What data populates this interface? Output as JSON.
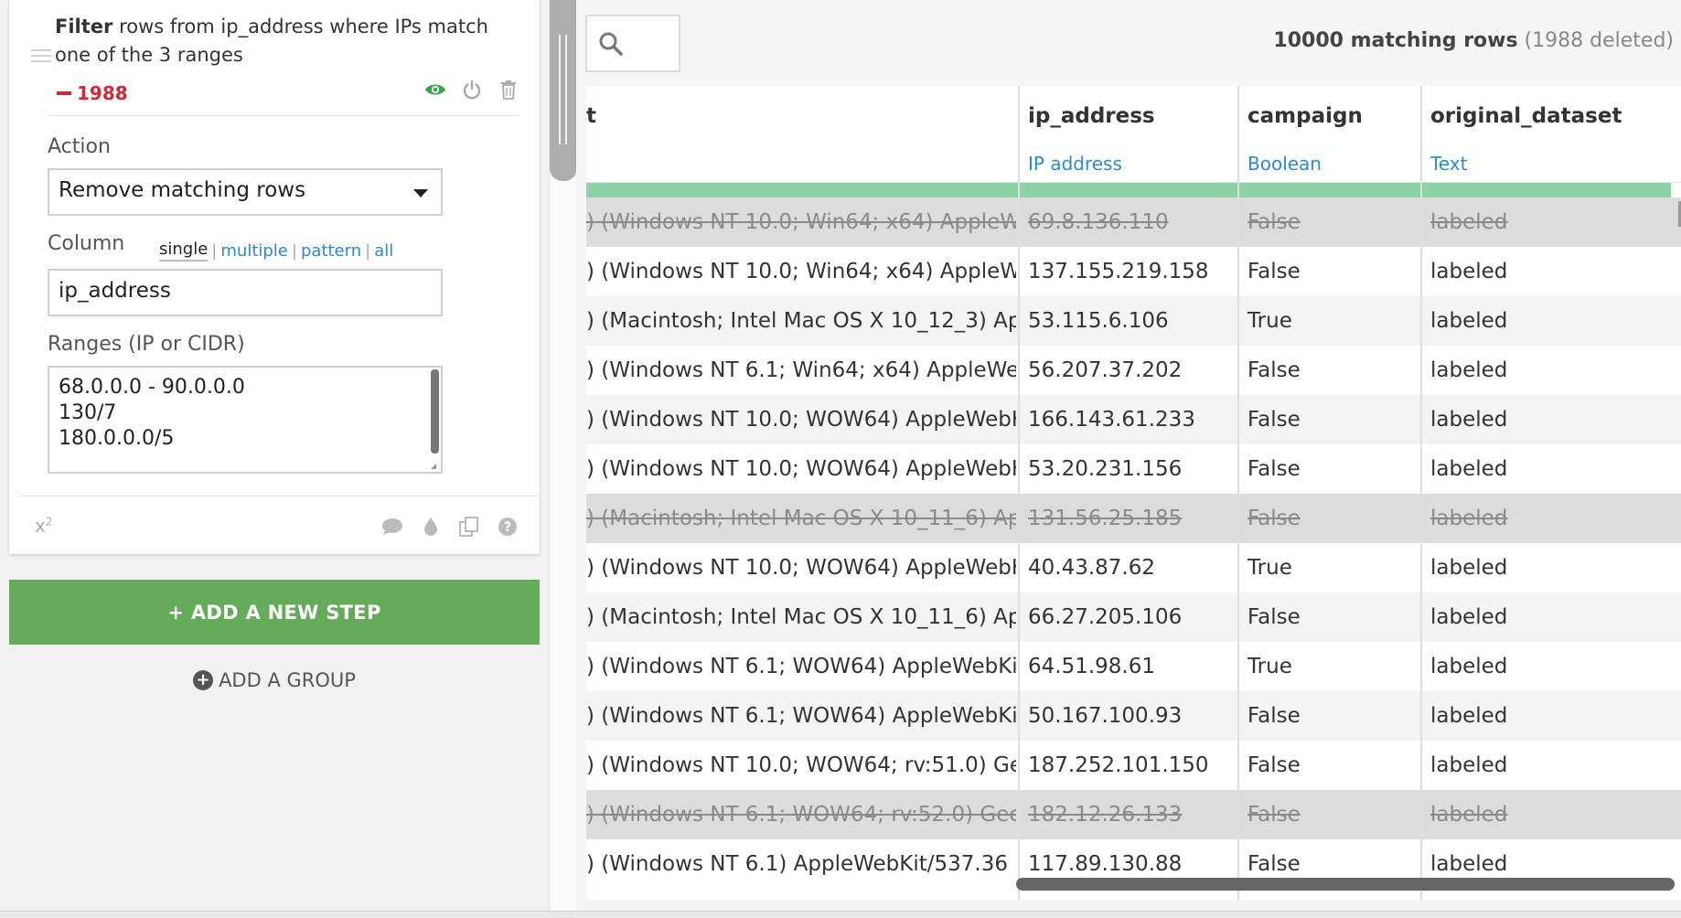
{
  "step": {
    "title_bold": "Filter",
    "title_rest": " rows from ip_address where IPs match one of the 3 ranges",
    "delete_count": "1988",
    "action_label": "Action",
    "action_value": "Remove matching rows",
    "column_label": "Column",
    "column_modes": [
      "single",
      "multiple",
      "pattern",
      "all"
    ],
    "column_value": "ip_address",
    "ranges_label": "Ranges (IP or CIDR)",
    "ranges": [
      "68.0.0.0 - 90.0.0.0",
      "130/7",
      "180.0.0.0/5"
    ],
    "footer_left": "x",
    "footer_left_sup": "2"
  },
  "buttons": {
    "add_step": "+ ADD A NEW STEP",
    "add_group": "ADD A GROUP",
    "add_group_icon": "+"
  },
  "grid": {
    "matching_count": "10000 matching rows",
    "deleted_note": "(1988 deleted)",
    "columns": [
      {
        "name": "t",
        "type": ""
      },
      {
        "name": "ip_address",
        "type": "IP address"
      },
      {
        "name": "campaign",
        "type": "Boolean"
      },
      {
        "name": "original_dataset",
        "type": "Text"
      }
    ],
    "rows": [
      {
        "ua": ") (Windows NT 10.0; Win64; x64) AppleW…",
        "ip": "69.8.136.110",
        "campaign": "False",
        "dataset": "labeled",
        "deleted": true
      },
      {
        "ua": ") (Windows NT 10.0; Win64; x64) AppleW…",
        "ip": "137.155.219.158",
        "campaign": "False",
        "dataset": "labeled",
        "deleted": false
      },
      {
        "ua": ") (Macintosh; Intel Mac OS X 10_12_3) Ap…",
        "ip": "53.115.6.106",
        "campaign": "True",
        "dataset": "labeled",
        "deleted": false
      },
      {
        "ua": ") (Windows NT 6.1; Win64; x64) AppleWe…",
        "ip": "56.207.37.202",
        "campaign": "False",
        "dataset": "labeled",
        "deleted": false
      },
      {
        "ua": ") (Windows NT 10.0; WOW64) AppleWebK…",
        "ip": "166.143.61.233",
        "campaign": "False",
        "dataset": "labeled",
        "deleted": false
      },
      {
        "ua": ") (Windows NT 10.0; WOW64) AppleWebK…",
        "ip": "53.20.231.156",
        "campaign": "False",
        "dataset": "labeled",
        "deleted": false
      },
      {
        "ua": ") (Macintosh; Intel Mac OS X 10_11_6) Ap…",
        "ip": "131.56.25.185",
        "campaign": "False",
        "dataset": "labeled",
        "deleted": true
      },
      {
        "ua": ") (Windows NT 10.0; WOW64) AppleWebK…",
        "ip": "40.43.87.62",
        "campaign": "True",
        "dataset": "labeled",
        "deleted": false
      },
      {
        "ua": ") (Macintosh; Intel Mac OS X 10_11_6) Ap…",
        "ip": "66.27.205.106",
        "campaign": "False",
        "dataset": "labeled",
        "deleted": false
      },
      {
        "ua": ") (Windows NT 6.1; WOW64) AppleWebKit…",
        "ip": "64.51.98.61",
        "campaign": "True",
        "dataset": "labeled",
        "deleted": false
      },
      {
        "ua": ") (Windows NT 6.1; WOW64) AppleWebKit…",
        "ip": "50.167.100.93",
        "campaign": "False",
        "dataset": "labeled",
        "deleted": false
      },
      {
        "ua": ") (Windows NT 10.0; WOW64; rv:51.0) Gec…",
        "ip": "187.252.101.150",
        "campaign": "False",
        "dataset": "labeled",
        "deleted": false
      },
      {
        "ua": ") (Windows NT 6.1; WOW64; rv:52.0) Geck…",
        "ip": "182.12.26.133",
        "campaign": "False",
        "dataset": "labeled",
        "deleted": true
      },
      {
        "ua": ") (Windows NT 6.1) AppleWebKit/537.36 (…",
        "ip": "117.89.130.88",
        "campaign": "False",
        "dataset": "labeled",
        "deleted": false
      }
    ]
  },
  "icons": {
    "drag": "drag-handle-icon",
    "visibility": "eye-icon",
    "power": "power-icon",
    "delete": "trash-icon",
    "comment": "comment-icon",
    "color": "drop-icon",
    "duplicate": "copy-icon",
    "help": "help-icon",
    "search": "search-icon"
  },
  "colors": {
    "accent_green": "#64ac5a",
    "delete_red": "#d0283a",
    "link_blue": "#2b8ad2",
    "eye_green": "#3aa645",
    "processed_bar": "#8dd3a8"
  }
}
